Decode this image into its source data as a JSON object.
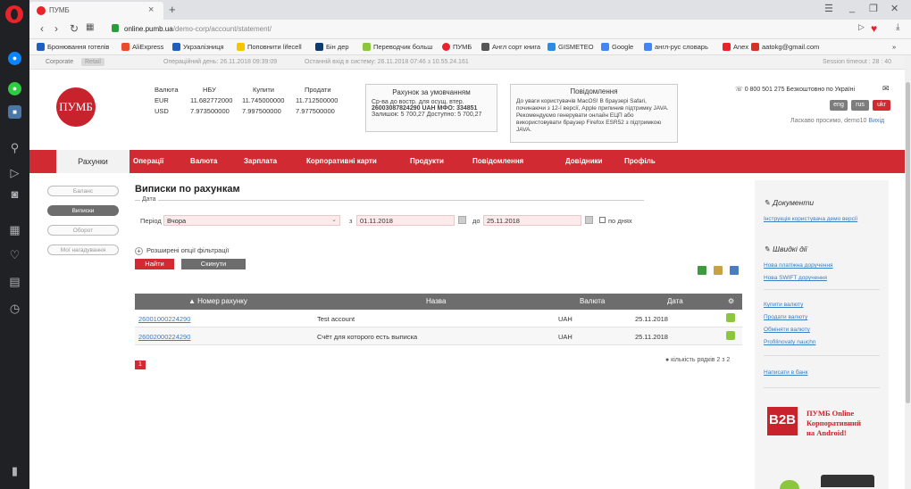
{
  "browser": {
    "tab_title": "ПУМБ",
    "tab_close": "×",
    "new_tab": "+",
    "url_domain": "online.pumb.ua",
    "url_path": "/demo-corp/account/statement/",
    "bookmarks": [
      "Бронювання готелів",
      "AliExpress",
      "Укрзалізниця",
      "Поповнити lifecell",
      "Бiн дер",
      "Переводчик больш",
      "ПУМБ",
      "Англ сорт книга",
      "GISMETEO",
      "Google",
      "англ-рус словарь",
      "Anex",
      "aatokg@gmail.com"
    ],
    "more_bookmarks": "»"
  },
  "strip": {
    "tab_corporate": "Corporate",
    "tab_retail": "Retail",
    "operday": "Операційний день: 26.11.2018 09:39:09",
    "last_login": "Останній вхід в систему: 26.11.2018 07:46 з 10.55.24.161",
    "session": "Session timeout : 28 : 40"
  },
  "header": {
    "logo_text": "ПУМБ",
    "rates": {
      "h_currency": "Валюта",
      "h_nbu": "НБУ",
      "h_buy": "Купити",
      "h_sell": "Продати",
      "rows": [
        {
          "cur": "EUR",
          "nbu": "11.682772000",
          "buy": "11.745000000",
          "sell": "11.712500000"
        },
        {
          "cur": "USD",
          "nbu": "7.973500000",
          "buy": "7.997500000",
          "sell": "7.977500000"
        }
      ]
    },
    "default_account": {
      "title": "Рахунок за умовчанням",
      "line1": "Ср-ва до востр. для осущ. втер.",
      "line2": "26003087824290 UAH МФО: 334851",
      "line3": "Залишок: 5 700,27 Доступно: 5 700,27"
    },
    "notifications": {
      "title": "Повідомлення",
      "text": "До уваги користувачів MacOS! В браузері Safari, починаючи з 12-ї версії, Apple припинив підтримку JAVA. Рекомендуємо генерувати онлайн ЕЦП або використовувати браузер Firefox ESR52 з підтримкою JAVA."
    },
    "phone": "0 800 501 275 Безкоштовно по Україні",
    "lang_eng": "eng",
    "lang_rus": "rus",
    "lang_ukr": "ukr",
    "welcome": "Ласкаво просимо, demo10",
    "logout": "Вихід"
  },
  "menu": {
    "active": "Рахунки",
    "items": [
      "Операції",
      "Валюта",
      "Зарплата",
      "Корпоративні карти",
      "Продукти",
      "Повідомлення",
      "Довідники",
      "Профіль"
    ]
  },
  "leftnav": [
    "Баланс",
    "Виписки",
    "Оборот",
    "Мої нагадування"
  ],
  "main": {
    "title": "Виписки по рахункам",
    "filter_legend": "Дата",
    "period_label": "Період",
    "period_value": "Вчора",
    "from_label": "з",
    "from_date": "01.11.2018",
    "to_label": "до",
    "to_date": "25.11.2018",
    "by_days": "по днях",
    "advanced": "Розширені опції фільтрації",
    "find_btn": "Найти",
    "reset_btn": "Скинути",
    "table": {
      "headers": [
        "▲ Номер рахунку",
        "Назва",
        "Валюта",
        "Дата"
      ],
      "rows": [
        {
          "account": "26001000224290",
          "name": "Test account",
          "currency": "UAH",
          "date": "25.11.2018"
        },
        {
          "account": "26002000224290",
          "name": "Счёт для которого есть выписка",
          "currency": "UAH",
          "date": "25.11.2018"
        }
      ]
    },
    "page": "1",
    "row_count": "● кількість рядків 2 з 2"
  },
  "right": {
    "docs_title": "Документи",
    "docs_link": "Інструкція користувача демо версії",
    "quick_title": "Швидкі дії",
    "quick_links": [
      "Нова платіжна доручення",
      "Нова SWIFT доручення"
    ],
    "currency_links": [
      "Купити валюту",
      "Продати валюту",
      "Обміняти валюту",
      "Profilinovaty nauchn"
    ],
    "write_bank": "Написати в банк",
    "promo_b2b": "B2B",
    "promo_line1": "ПУМБ Online",
    "promo_line2": "Корпоративний",
    "promo_line3": "на Android!"
  },
  "colors": {
    "brand_red": "#d12a32",
    "table_header": "#6d6d6d",
    "link": "#3a7ec4"
  }
}
